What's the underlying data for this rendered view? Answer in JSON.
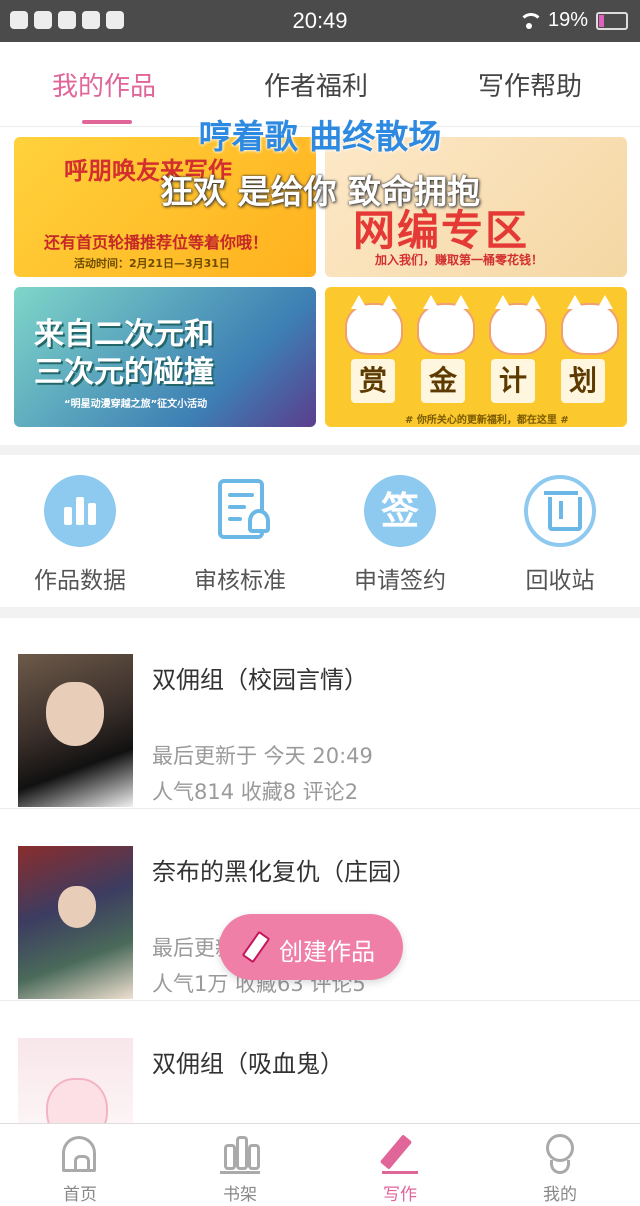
{
  "status_bar": {
    "time": "20:49",
    "battery": "19%",
    "battery_level": 0.19
  },
  "tabs": [
    {
      "label": "我的作品",
      "active": true
    },
    {
      "label": "作者福利",
      "active": false
    },
    {
      "label": "写作帮助",
      "active": false
    }
  ],
  "overlay_lyrics": {
    "line1": "哼着歌 曲终散场",
    "line2": "狂欢 是给你 致命拥抱"
  },
  "banners": {
    "b1": {
      "line1": "呼朋唤友来写作",
      "line2": "还有首页轮播推荐位等着你哦！",
      "line3": "活动时间：2月21日—3月31日"
    },
    "b2": {
      "line1": "网编专区",
      "line2": "加入我们，赚取第一桶零花钱！"
    },
    "b3": {
      "line1": "来自二次元和",
      "line2": "三次元的碰撞",
      "line3": "“明星动漫穿越之旅”征文小活动"
    },
    "b4": {
      "chars": [
        "赏",
        "金",
        "计",
        "划"
      ],
      "line2": "# 你所关心的更新福利，都在这里 #"
    }
  },
  "quick_actions": [
    {
      "label": "作品数据",
      "icon": "bar-chart-icon"
    },
    {
      "label": "审核标准",
      "icon": "review-document-icon"
    },
    {
      "label": "申请签约",
      "icon": "sign-contract-icon"
    },
    {
      "label": "回收站",
      "icon": "trash-icon"
    }
  ],
  "works": [
    {
      "title": "双佣组（校园言情）",
      "updated": "最后更新于 今天 20:49",
      "stats": "人气814 收藏8 评论2"
    },
    {
      "title": "奈布的黑化复仇（庄园）",
      "updated": "最后更新于 今天 20:49",
      "stats": "人气1万 收藏63 评论5"
    },
    {
      "title": "双佣组（吸血鬼）",
      "updated": "",
      "stats": ""
    }
  ],
  "fab": {
    "label": "创建作品",
    "icon": "pencil-icon"
  },
  "bottom_nav": [
    {
      "label": "首页",
      "icon": "home-icon",
      "active": false
    },
    {
      "label": "书架",
      "icon": "bookshelf-icon",
      "active": false
    },
    {
      "label": "写作",
      "icon": "pen-icon",
      "active": true
    },
    {
      "label": "我的",
      "icon": "profile-icon",
      "active": false
    }
  ],
  "colors": {
    "accent": "#e0669a",
    "fab": "#f07fa8",
    "icon_blue": "#8ec9f0"
  }
}
